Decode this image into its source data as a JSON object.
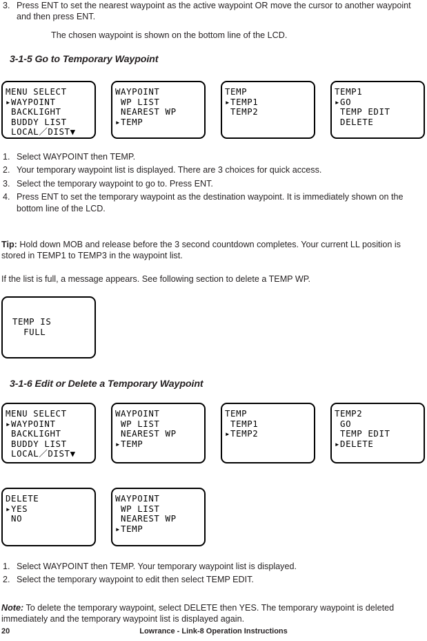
{
  "top_list": [
    {
      "num": "3.",
      "text": "Press ENT to set the nearest waypoint as the active waypoint OR move the cursor to another waypoint and then press ENT."
    }
  ],
  "top_note": "The chosen waypoint is shown on the bottom line of the LCD.",
  "section_3_1_5": {
    "heading": "3-1-5 Go to Temporary Waypoint",
    "screens": [
      {
        "name": "menu-select",
        "lines": [
          "MENU SELECT",
          "▸WAYPOINT",
          " BACKLIGHT",
          " BUDDY LIST",
          " LOCAL／DIST▼"
        ]
      },
      {
        "name": "waypoint-menu",
        "lines": [
          "WAYPOINT",
          " WP LIST",
          " NEAREST WP",
          "▸TEMP"
        ]
      },
      {
        "name": "temp-list",
        "lines": [
          "TEMP",
          "▸TEMP1",
          " TEMP2"
        ]
      },
      {
        "name": "temp1-options",
        "lines": [
          "TEMP1",
          "▸GO",
          " TEMP EDIT",
          " DELETE"
        ]
      }
    ],
    "steps": [
      {
        "num": "1.",
        "text": "Select WAYPOINT then TEMP."
      },
      {
        "num": "2.",
        "text": "Your temporary waypoint list is displayed. There are 3 choices for quick access."
      },
      {
        "num": "3.",
        "text": "Select the temporary waypoint to go to. Press ENT."
      },
      {
        "num": "4.",
        "text": "Press ENT to set the temporary waypoint as the destination waypoint. It is immediately shown on the bottom line of the LCD."
      }
    ],
    "tip": {
      "label": "Tip:",
      "text": " Hold down MOB and release before the 3 second countdown completes. Your current LL position is stored in TEMP1 to TEMP3 in the waypoint list."
    },
    "full_note": "If the list is full, a message appears. See following section to delete a TEMP WP.",
    "full_screen": {
      "name": "temp-is-full",
      "lines": [
        "TEMP IS",
        "  FULL"
      ]
    }
  },
  "section_3_1_6": {
    "heading": "3-1-6 Edit or Delete a Temporary Waypoint",
    "screens_row1": [
      {
        "name": "menu-select",
        "lines": [
          "MENU SELECT",
          "▸WAYPOINT",
          " BACKLIGHT",
          " BUDDY LIST",
          " LOCAL／DIST▼"
        ]
      },
      {
        "name": "waypoint-menu",
        "lines": [
          "WAYPOINT",
          " WP LIST",
          " NEAREST WP",
          "▸TEMP"
        ]
      },
      {
        "name": "temp-list",
        "lines": [
          "TEMP",
          " TEMP1",
          "▸TEMP2"
        ]
      },
      {
        "name": "temp2-options",
        "lines": [
          "TEMP2",
          " GO",
          " TEMP EDIT",
          "▸DELETE"
        ]
      }
    ],
    "screens_row2": [
      {
        "name": "delete-confirm",
        "lines": [
          "DELETE",
          "▸YES",
          " NO"
        ]
      },
      {
        "name": "waypoint-menu",
        "lines": [
          "WAYPOINT",
          " WP LIST",
          " NEAREST WP",
          "▸TEMP"
        ]
      }
    ],
    "steps": [
      {
        "num": "1.",
        "text": "Select WAYPOINT then TEMP. Your temporary waypoint list is displayed."
      },
      {
        "num": "2.",
        "text": "Select the temporary waypoint to edit then select TEMP EDIT."
      }
    ],
    "note": {
      "label": "Note:",
      "text": " To delete the temporary waypoint, select DELETE then YES. The temporary waypoint is deleted immediately and the temporary waypoint list is displayed again."
    }
  },
  "footer": {
    "page_number": "20",
    "text": "Lowrance - Link-8 Operation Instructions"
  }
}
